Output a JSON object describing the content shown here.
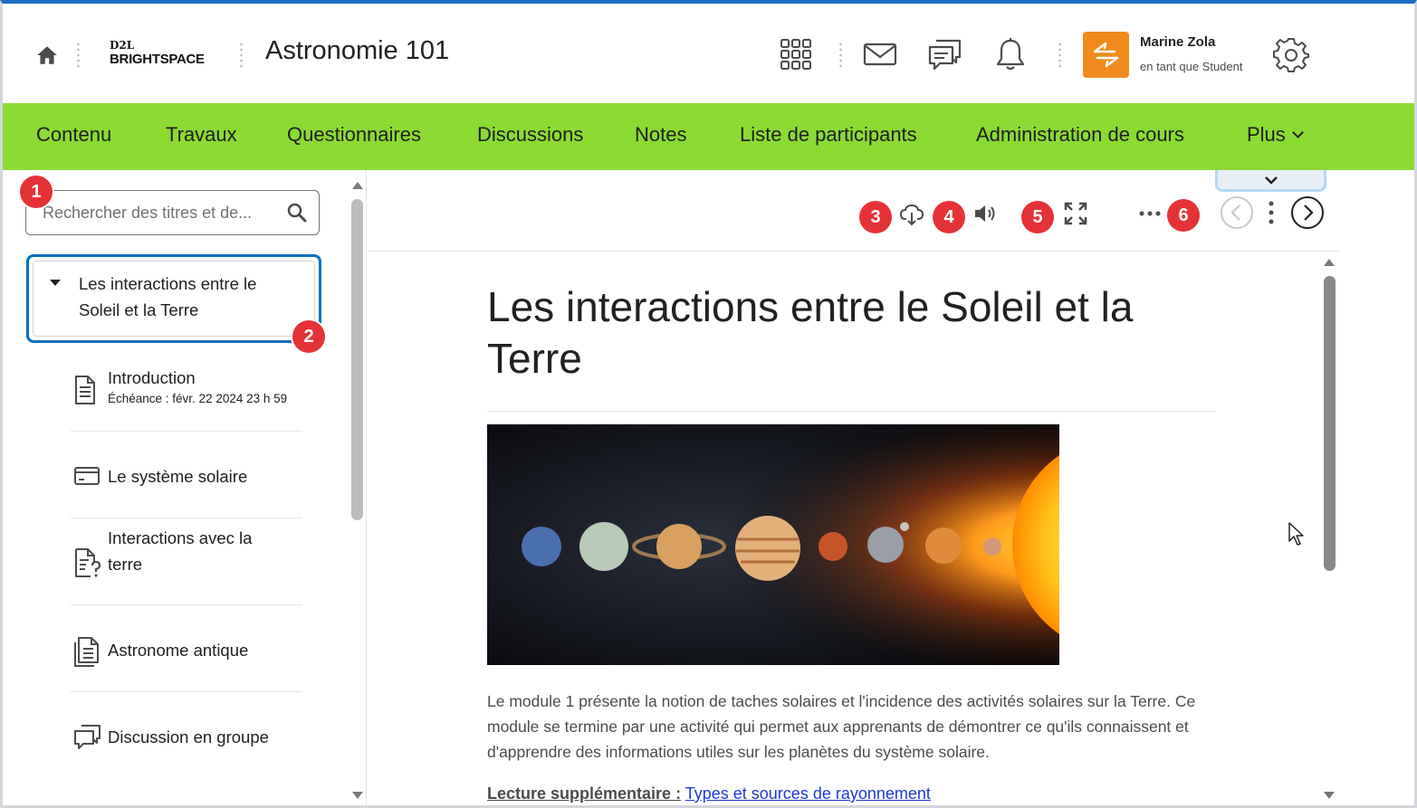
{
  "header": {
    "logo_top": "D2L",
    "logo_bottom": "BRIGHTSPACE",
    "course_title": "Astronomie 101",
    "user": {
      "name": "Marine Zola",
      "role": "en tant que Student"
    }
  },
  "nav": {
    "items": [
      "Contenu",
      "Travaux",
      "Questionnaires",
      "Discussions",
      "Notes",
      "Liste de participants",
      "Administration de cours",
      "Plus"
    ]
  },
  "sidebar": {
    "search_placeholder": "Rechercher des titres et de...",
    "module": {
      "title": "Les interactions entre le Soleil et la Terre"
    },
    "topics": [
      {
        "label": "Introduction",
        "due": "Échéance : févr. 22 2024 23 h 59",
        "icon": "document-icon"
      },
      {
        "label": "Le système solaire",
        "icon": "media-icon"
      },
      {
        "label": "Interactions avec la terre",
        "icon": "quiz-icon"
      },
      {
        "label": "Astronome antique",
        "icon": "checklist-icon"
      },
      {
        "label": "Discussion en groupe",
        "icon": "discussion-icon"
      }
    ]
  },
  "callouts": [
    "1",
    "2",
    "3",
    "4",
    "5",
    "6"
  ],
  "content": {
    "title": "Les interactions entre le Soleil et la Terre",
    "image_alt": "Planètes du système solaire alignées devant le Soleil",
    "paragraph": "Le module 1 présente la notion de taches solaires et l'incidence des activités solaires sur la Terre. Ce module se termine par une activité qui permet aux apprenants de démontrer ce qu'ils connaissent et d'apprendre des informations utiles sur les planètes du système solaire.",
    "extra_label": "Lecture supplémentaire :",
    "extra_link": "Types et sources de rayonnement"
  },
  "colors": {
    "nav_bg": "#8bdb33",
    "accent_blue": "#006fbf",
    "badge_red": "#e53237",
    "avatar_orange": "#f18a1c",
    "link": "#1f38d6"
  }
}
